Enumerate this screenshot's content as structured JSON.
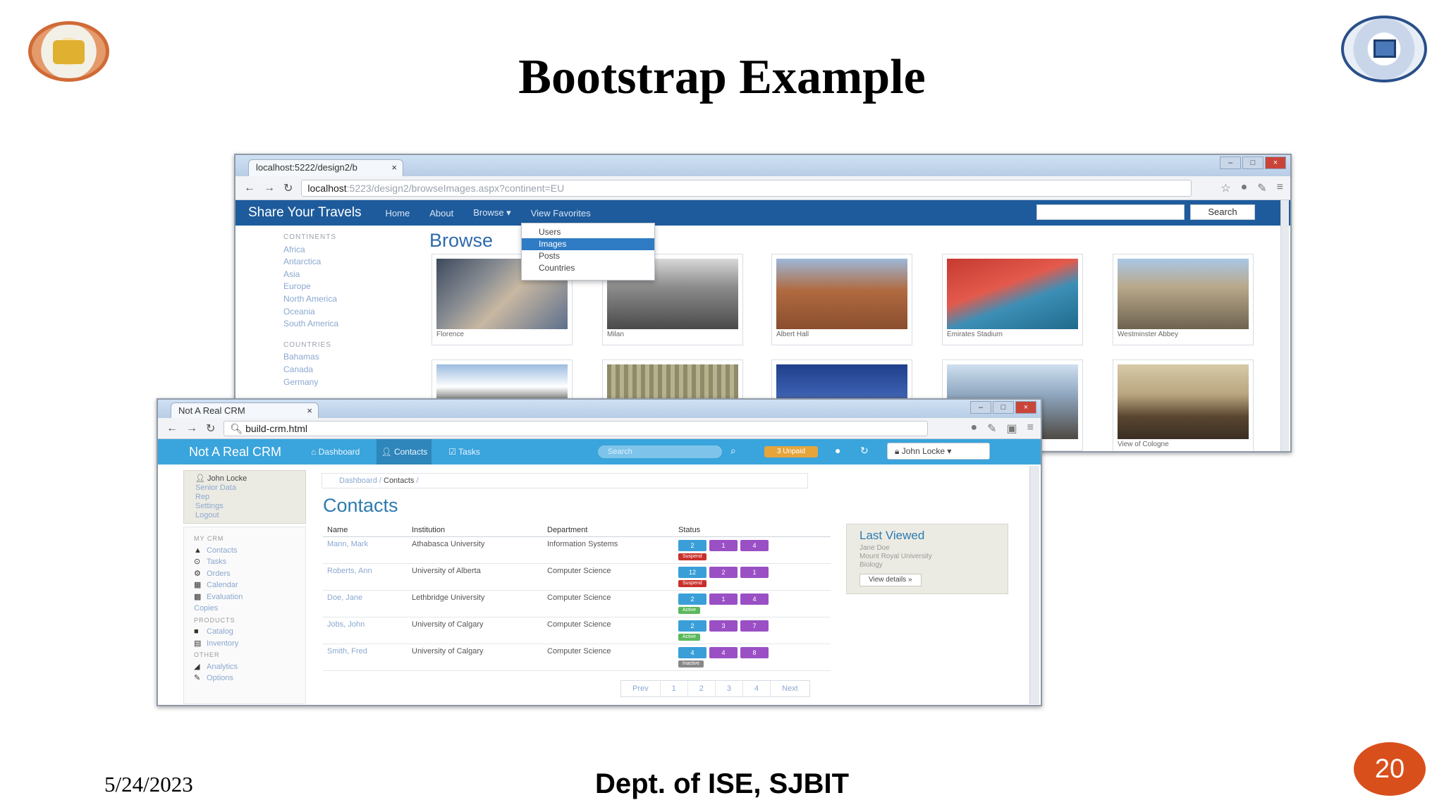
{
  "slide": {
    "title": "Bootstrap Example",
    "date": "5/24/2023",
    "footer": "Dept. of ISE, SJBIT",
    "page_number": "20"
  },
  "browser1": {
    "tab_title": "localhost:5222/design2/b",
    "url_host": "localhost",
    "url_rest": ":5223/design2/browseImages.aspx?continent=EU",
    "brand": "Share Your Travels",
    "nav": [
      "Home",
      "About",
      "Browse ▾",
      "View Favorites"
    ],
    "search_button": "Search",
    "sidebar_continents_header": "CONTINENTS",
    "continents": [
      "Africa",
      "Antarctica",
      "Asia",
      "Europe",
      "North America",
      "Oceania",
      "South America"
    ],
    "sidebar_countries_header": "COUNTRIES",
    "countries": [
      "Bahamas",
      "Canada",
      "Germany"
    ],
    "heading": "Browse",
    "dropdown": [
      "Users",
      "Images",
      "Posts",
      "Countries"
    ],
    "dropdown_selected": "Images",
    "images_row1": [
      "Florence",
      "Milan",
      "Albert Hall",
      "Emirates Stadium",
      "Westminster Abbey"
    ],
    "images_row2_last_caption": "View of Cologne"
  },
  "browser2": {
    "tab_title": "Not A Real CRM",
    "url": "build-crm.html",
    "brand": "Not A Real CRM",
    "nav": [
      "Dashboard",
      "Contacts",
      "Tasks"
    ],
    "search_placeholder": "Search",
    "badge": "3 Unpaid",
    "user_menu": "John Locke ▾",
    "user_box": {
      "name": "John Locke",
      "lines": [
        "Senior Data",
        "Rep",
        "Settings",
        "Logout"
      ]
    },
    "menu_header_crm": "MY CRM",
    "menu_crm": [
      "Contacts",
      "Tasks",
      "Orders",
      "Calendar",
      "Evaluation",
      "Copies"
    ],
    "menu_header_products": "PRODUCTS",
    "menu_products": [
      "Catalog",
      "Inventory"
    ],
    "menu_header_other": "OTHER",
    "menu_other": [
      "Analytics",
      "Options"
    ],
    "breadcrumb_root": "Dashboard",
    "breadcrumb_current": "Contacts",
    "heading": "Contacts",
    "table_headers": [
      "Name",
      "Institution",
      "Department",
      "Status"
    ],
    "rows": [
      {
        "name": "Mann, Mark",
        "institution": "Athabasca University",
        "department": "Information Systems",
        "pills": [
          "2",
          "1",
          "4"
        ],
        "tag": "Suspend"
      },
      {
        "name": "Roberts, Ann",
        "institution": "University of Alberta",
        "department": "Computer Science",
        "pills": [
          "12",
          "2",
          "1"
        ],
        "tag": "Suspend"
      },
      {
        "name": "Doe, Jane",
        "institution": "Lethbridge University",
        "department": "Computer Science",
        "pills": [
          "2",
          "1",
          "4"
        ],
        "tag": "Active"
      },
      {
        "name": "Jobs, John",
        "institution": "University of Calgary",
        "department": "Computer Science",
        "pills": [
          "2",
          "3",
          "7"
        ],
        "tag": "Active"
      },
      {
        "name": "Smith, Fred",
        "institution": "University of Calgary",
        "department": "Computer Science",
        "pills": [
          "4",
          "4",
          "8"
        ],
        "tag": "Inactive"
      }
    ],
    "last_viewed": {
      "title": "Last Viewed",
      "lines": [
        "Jane Doe",
        "Mount Royal University",
        "Biology"
      ],
      "button": "View details »"
    },
    "pager": [
      "Prev",
      "1",
      "2",
      "3",
      "4",
      "Next"
    ]
  },
  "colors": {
    "brand_blue": "#1e5b9c",
    "crm_blue": "#3aa4dc",
    "page_badge": "#d94f1b"
  }
}
